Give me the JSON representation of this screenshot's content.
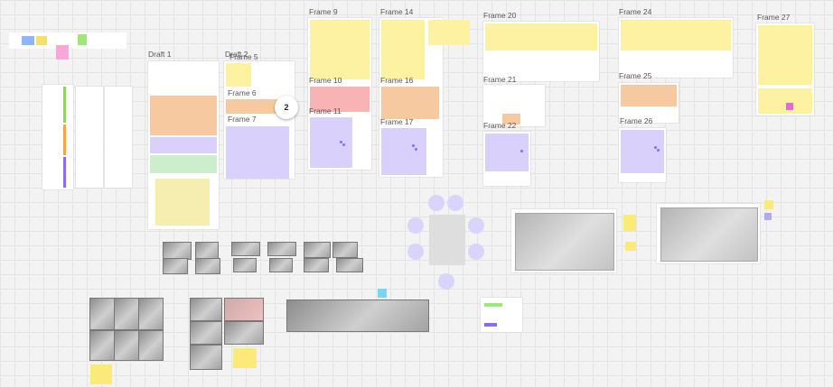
{
  "canvas": {
    "background": "#f3f3f3",
    "grid_color": "#e4e4e4"
  },
  "frames": {
    "draft1": "Draft 1",
    "draft2": "Draft 2",
    "f5": "Frame 5",
    "f6": "Frame 6",
    "f7": "Frame 7",
    "f9": "Frame 9",
    "f10": "Frame 10",
    "f11": "Frame 11",
    "f14": "Frame 14",
    "f16": "Frame 16",
    "f17": "Frame 17",
    "f20": "Frame 20",
    "f21": "Frame 21",
    "f22": "Frame 22",
    "f24": "Frame 24",
    "f25": "Frame 25",
    "f26": "Frame 26",
    "f27": "Frame 27"
  },
  "badge": {
    "count": "2"
  },
  "colors": {
    "yellow": "#fdf2a2",
    "orange": "#f7c9a1",
    "purple": "#d9d0fb",
    "green": "#cdeecc",
    "pink": "#f8b4b4"
  }
}
